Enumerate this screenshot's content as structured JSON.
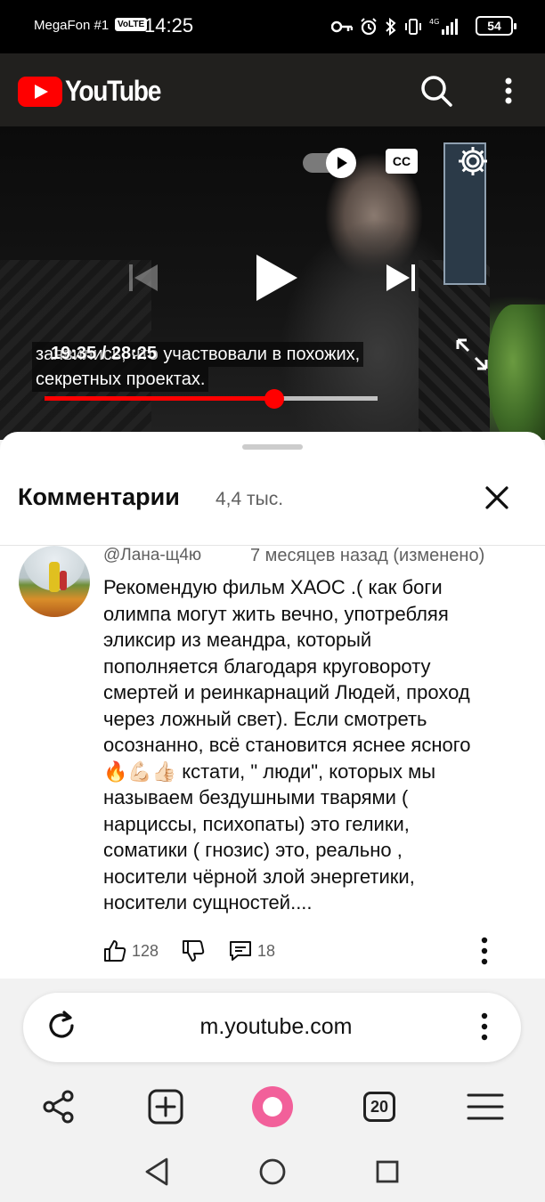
{
  "status_bar": {
    "carrier": "MegaFon #1",
    "volte": "VoLTE",
    "time": "14:25",
    "battery": "54"
  },
  "youtube": {
    "logo_text": "YouTube"
  },
  "video": {
    "cc_label": "CC",
    "timestamp": "19:35 / 28:25",
    "subtitle_line1": "заявились, что участвовали в похожих,",
    "subtitle_line2": "секретных проектах.",
    "progress_fraction": 0.69,
    "buffered_fraction": 1.0
  },
  "comments": {
    "title": "Комментарии",
    "count": "4,4 тыс.",
    "items": [
      {
        "author": "@Лана-щ4ю",
        "date": "7 месяцев назад (изменено)",
        "text": "Рекомендую фильм ХАОС  .( как боги\nолимпа могут жить вечно, употребляя\nэликсир из меандра, который\nпополняется благодаря круговороту\nсмертей и реинкарнаций  Людей, проход\nчерез ложный свет).  Если смотреть\nосознанно, всё становится яснее ясного\n🔥💪🏻👍🏻 кстати, \" люди\", которых мы\nназываем бездушными тварями (\nнарциссы, психопаты) это гелики,\nсоматики ( гнозис) это, реально ,\nносители чёрной злой энергетики,\nносители сущностей....",
        "likes": "128",
        "replies": "18"
      }
    ]
  },
  "browser": {
    "url": "m.youtube.com",
    "tab_count": "20"
  }
}
